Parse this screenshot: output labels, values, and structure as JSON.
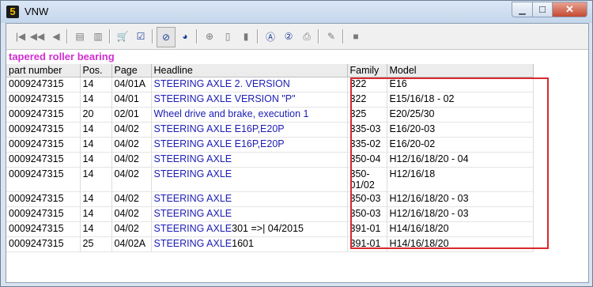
{
  "window": {
    "title": "VNW",
    "app_icon_letter": "5"
  },
  "controls": {
    "minimize": "▁",
    "maximize": "☐",
    "close": "✕"
  },
  "toolbar": {
    "buttons": [
      "first-icon",
      "prev-page-icon",
      "prev-icon",
      "doc-back-icon",
      "doc-forward-icon",
      "cart-icon",
      "checklist-icon",
      "no-entry-icon",
      "globe-icon",
      "zoom-icon",
      "page-icon",
      "page-next-icon",
      "at-icon",
      "info-icon",
      "print-icon",
      "edit-icon",
      "stop-icon"
    ]
  },
  "subtitle": "tapered roller bearing",
  "columns": [
    "part number",
    "Pos.",
    "Page",
    "Headline",
    "Family",
    "Model"
  ],
  "rows": [
    {
      "part": "0009247315",
      "pos": "14",
      "page": "04/01A",
      "headline": "STEERING AXLE 2. VERSION",
      "extra": "",
      "family": "322",
      "model": "E16"
    },
    {
      "part": "0009247315",
      "pos": "14",
      "page": "04/01",
      "headline": "STEERING AXLE VERSION \"P\"",
      "extra": "",
      "family": "322",
      "model": "E15/16/18 - 02"
    },
    {
      "part": "0009247315",
      "pos": "20",
      "page": "02/01",
      "headline": "Wheel drive and brake, execution 1",
      "extra": "",
      "family": "325",
      "model": "E20/25/30"
    },
    {
      "part": "0009247315",
      "pos": "14",
      "page": "04/02",
      "headline": "STEERING AXLE E16P,E20P",
      "extra": "",
      "family": "335-03",
      "model": "E16/20-03"
    },
    {
      "part": "0009247315",
      "pos": "14",
      "page": "04/02",
      "headline": "STEERING AXLE E16P,E20P",
      "extra": "",
      "family": "335-02",
      "model": "E16/20-02"
    },
    {
      "part": "0009247315",
      "pos": "14",
      "page": "04/02",
      "headline": "STEERING AXLE",
      "extra": "",
      "family": "350-04",
      "model": "H12/16/18/20 - 04"
    },
    {
      "part": "0009247315",
      "pos": "14",
      "page": "04/02",
      "headline": "STEERING AXLE",
      "extra": "",
      "family": "350-01/02",
      "model": "H12/16/18"
    },
    {
      "part": "0009247315",
      "pos": "14",
      "page": "04/02",
      "headline": "STEERING AXLE",
      "extra": "",
      "family": "350-03",
      "model": "H12/16/18/20 - 03"
    },
    {
      "part": "0009247315",
      "pos": "14",
      "page": "04/02",
      "headline": "STEERING AXLE",
      "extra": "",
      "family": "350-03",
      "model": "H12/16/18/20 - 03"
    },
    {
      "part": "0009247315",
      "pos": "14",
      "page": "04/02",
      "headline": "STEERING AXLE",
      "extra": "301 =>| 04/2015",
      "family": "391-01",
      "model": "H14/16/18/20"
    },
    {
      "part": "0009247315",
      "pos": "25",
      "page": "04/02A",
      "headline": "STEERING AXLE",
      "extra": "1601",
      "family": "391-01",
      "model": "H14/16/18/20"
    }
  ],
  "highlight_color": "#d9292e"
}
